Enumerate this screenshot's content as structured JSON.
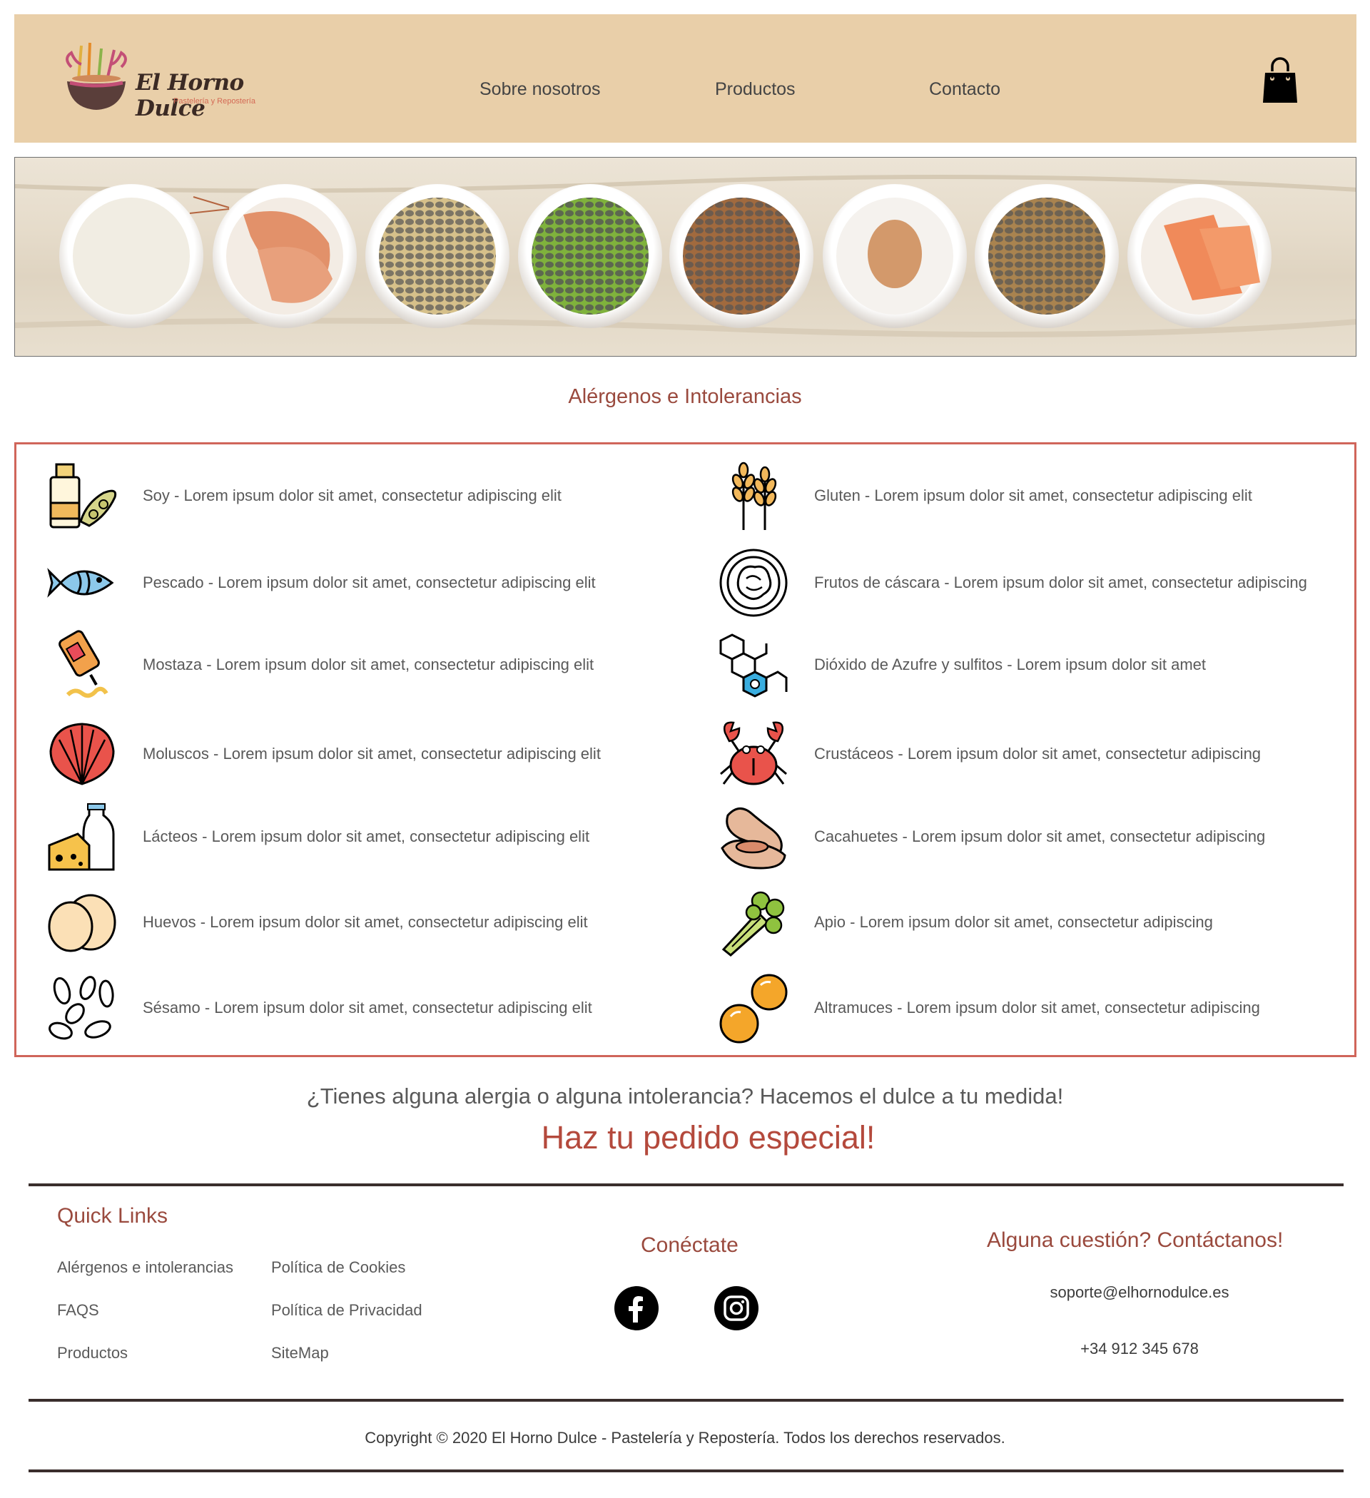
{
  "header": {
    "brand_name": "El Horno Dulce",
    "brand_tagline": "Pastelería y Repostería",
    "nav": [
      {
        "label": "Sobre nosotros"
      },
      {
        "label": "Productos"
      },
      {
        "label": "Contacto"
      }
    ],
    "cart_icon": "shopping-bag-icon"
  },
  "banner": {
    "bowls": [
      "milk",
      "shrimp",
      "peanuts",
      "edamame",
      "nuts",
      "egg",
      "wheat",
      "salmon"
    ]
  },
  "allergens": {
    "title": "Alérgenos e Intolerancias",
    "left": [
      {
        "icon": "soy-icon",
        "label": "Soy - Lorem ipsum dolor sit amet, consectetur adipiscing elit"
      },
      {
        "icon": "fish-icon",
        "label": "Pescado - Lorem ipsum dolor sit amet, consectetur adipiscing elit"
      },
      {
        "icon": "mustard-icon",
        "label": "Mostaza - Lorem ipsum dolor sit amet, consectetur adipiscing elit"
      },
      {
        "icon": "shell-icon",
        "label": "Moluscos - Lorem ipsum dolor sit amet, consectetur adipiscing elit"
      },
      {
        "icon": "dairy-icon",
        "label": "Lácteos - Lorem ipsum dolor sit amet, consectetur adipiscing elit"
      },
      {
        "icon": "eggs-icon",
        "label": "Huevos - Lorem ipsum dolor sit amet, consectetur adipiscing elit"
      },
      {
        "icon": "sesame-icon",
        "label": "Sésamo - Lorem ipsum dolor sit amet, consectetur adipiscing elit"
      }
    ],
    "right": [
      {
        "icon": "wheat-icon",
        "label": "Gluten - Lorem ipsum dolor sit amet, consectetur adipiscing elit"
      },
      {
        "icon": "walnut-icon",
        "label": "Frutos de cáscara - Lorem ipsum dolor sit amet, consectetur adipiscing"
      },
      {
        "icon": "molecule-icon",
        "label": "Dióxido de Azufre y sulfitos - Lorem ipsum dolor sit amet"
      },
      {
        "icon": "crab-icon",
        "label": "Crustáceos - Lorem ipsum dolor sit amet, consectetur adipiscing"
      },
      {
        "icon": "peanut-icon",
        "label": "Cacahuetes - Lorem ipsum dolor sit amet, consectetur adipiscing"
      },
      {
        "icon": "celery-icon",
        "label": "Apio - Lorem ipsum dolor sit amet, consectetur adipiscing"
      },
      {
        "icon": "lupin-icon",
        "label": "Altramuces - Lorem ipsum dolor sit amet, consectetur adipiscing"
      }
    ]
  },
  "promo": {
    "question": "¿Tienes alguna alergia o alguna intolerancia? Hacemos el dulce a tu medida!",
    "cta": "Haz tu pedido especial!"
  },
  "footer": {
    "quick_links_title": "Quick Links",
    "quick_links": [
      "Alérgenos e intolerancias",
      "Política de Cookies",
      "FAQS",
      "Política de Privacidad",
      "Productos",
      "SiteMap"
    ],
    "social_title": "Conéctate",
    "social": [
      "facebook-icon",
      "instagram-icon"
    ],
    "contact_title": "Alguna cuestión? Contáctanos!",
    "email": "soporte@elhornodulce.es",
    "phone": "+34 912 345 678",
    "copyright": "Copyright © 2020 El Horno Dulce - Pastelería y Repostería. Todos los derechos reservados."
  },
  "colors": {
    "header_bg": "#e9cfa9",
    "accent": "#9a4a3e",
    "cta": "#b4493c",
    "box_border": "#d0655a",
    "rule": "#3a2e2c"
  }
}
